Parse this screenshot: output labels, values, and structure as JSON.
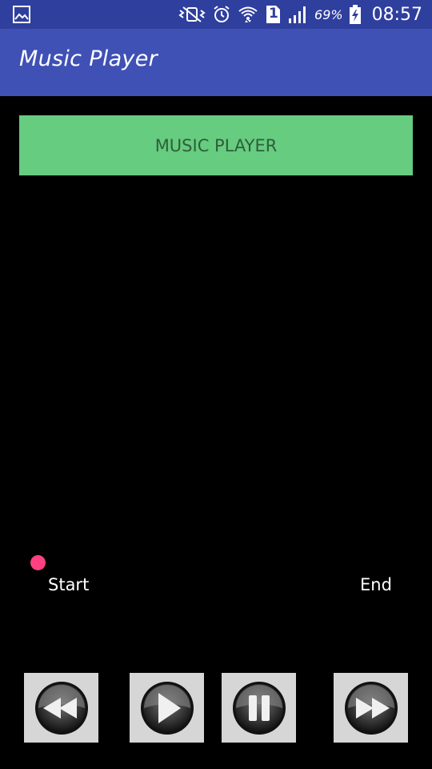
{
  "status_bar": {
    "battery_percent": "69%",
    "time": "08:57",
    "sim_slot": "1",
    "icons": [
      "image-icon",
      "vibrate-mute-icon",
      "alarm-icon",
      "wifi-icon",
      "sim-icon",
      "signal-icon",
      "battery-charging-icon"
    ]
  },
  "app_bar": {
    "title": "Music Player"
  },
  "banner": {
    "label": "MUSIC PLAYER",
    "color": "#66cc7f"
  },
  "seekbar": {
    "progress": 0,
    "start_label": "Start",
    "end_label": "End",
    "thumb_color": "#ff4081"
  },
  "controls": [
    {
      "name": "rewind",
      "icon": "rewind-icon"
    },
    {
      "name": "play",
      "icon": "play-icon"
    },
    {
      "name": "pause",
      "icon": "pause-icon"
    },
    {
      "name": "fast-forward",
      "icon": "fast-forward-icon"
    }
  ],
  "colors": {
    "status_bar": "#2f3f9e",
    "app_bar": "#3f51b5",
    "background": "#000000"
  }
}
